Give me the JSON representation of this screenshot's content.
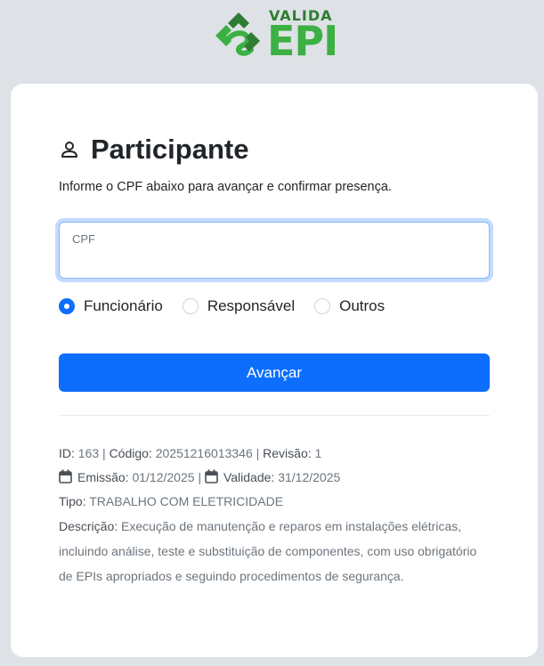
{
  "brand": {
    "small": "VALIDA",
    "big": "EPI",
    "colors": {
      "dark_green": "#2e7d32",
      "green": "#3cb043"
    }
  },
  "card": {
    "title": "Participante",
    "subtitle": "Informe o CPF abaixo para avançar e confirmar presença.",
    "cpf_field": {
      "label": "CPF",
      "value": ""
    },
    "radio_options": [
      {
        "label": "Funcionário",
        "checked": true
      },
      {
        "label": "Responsável",
        "checked": false
      },
      {
        "label": "Outros",
        "checked": false
      }
    ],
    "submit_label": "Avançar",
    "accent": "#0d6efd"
  },
  "details": {
    "id_label": "ID:",
    "id_value": "163",
    "sep": "|",
    "code_label": "Código:",
    "code_value": "20251216013346",
    "revision_label": "Revisão:",
    "revision_value": "1",
    "issue_label": "Emissão:",
    "issue_value": "01/12/2025",
    "validity_label": "Validade:",
    "validity_value": "31/12/2025",
    "type_label": "Tipo:",
    "type_value": "TRABALHO COM ELETRICIDADE",
    "description_label": "Descrição:",
    "description_value": "Execução de manutenção e reparos em instalações elétricas, incluindo análise, teste e substituição de componentes, com uso obrigatório de EPIs apropriados e seguindo procedimentos de segurança."
  }
}
